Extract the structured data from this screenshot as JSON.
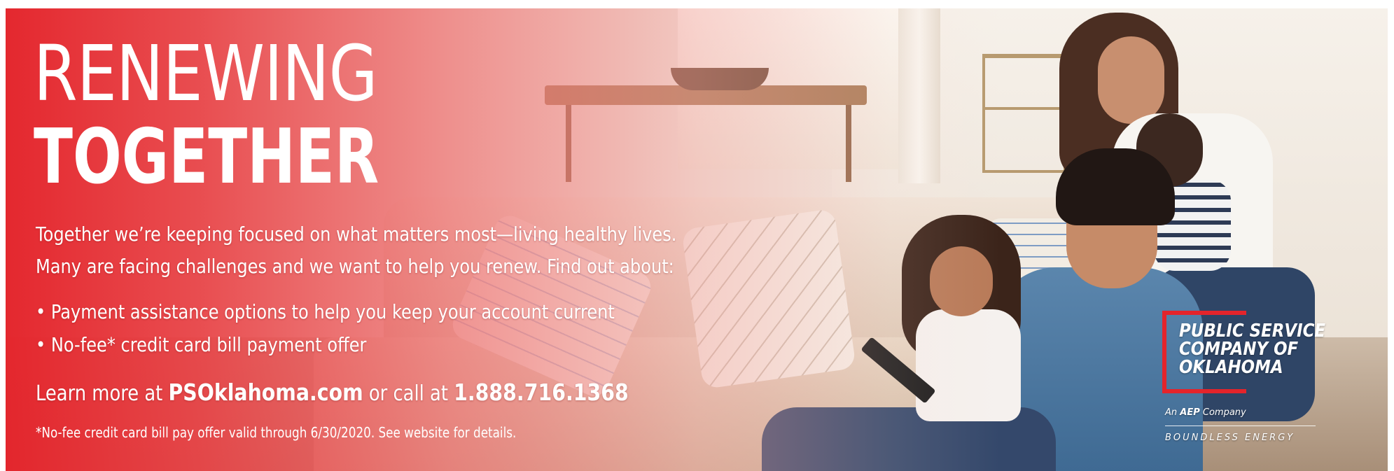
{
  "headline": {
    "line1": "RENEWING",
    "line2": "TOGETHER"
  },
  "body": {
    "line1": "Together we’re keeping focused on what matters most—living healthy lives.",
    "line2": "Many are facing challenges and we want to help you renew. Find out about:"
  },
  "bullets": [
    "• Payment assistance options to help you keep your account current",
    "• No-fee* credit card bill payment offer"
  ],
  "cta": {
    "prefix": "Learn more at ",
    "website": "PSOklahoma.com",
    "middle": " or call at ",
    "phone": "1.888.716.1368"
  },
  "disclaimer": "*No-fee credit card bill pay offer valid through 6/30/2020. See website for details.",
  "logo": {
    "line1": "PUBLIC SERVICE",
    "line2": "COMPANY OF",
    "line3": "OKLAHOMA",
    "aep_prefix": "An ",
    "aep_brand": "AEP",
    "aep_suffix": " Company",
    "tagline": "BOUNDLESS ENERGY"
  },
  "colors": {
    "brand_red": "#e4242b",
    "text": "#ffffff"
  }
}
